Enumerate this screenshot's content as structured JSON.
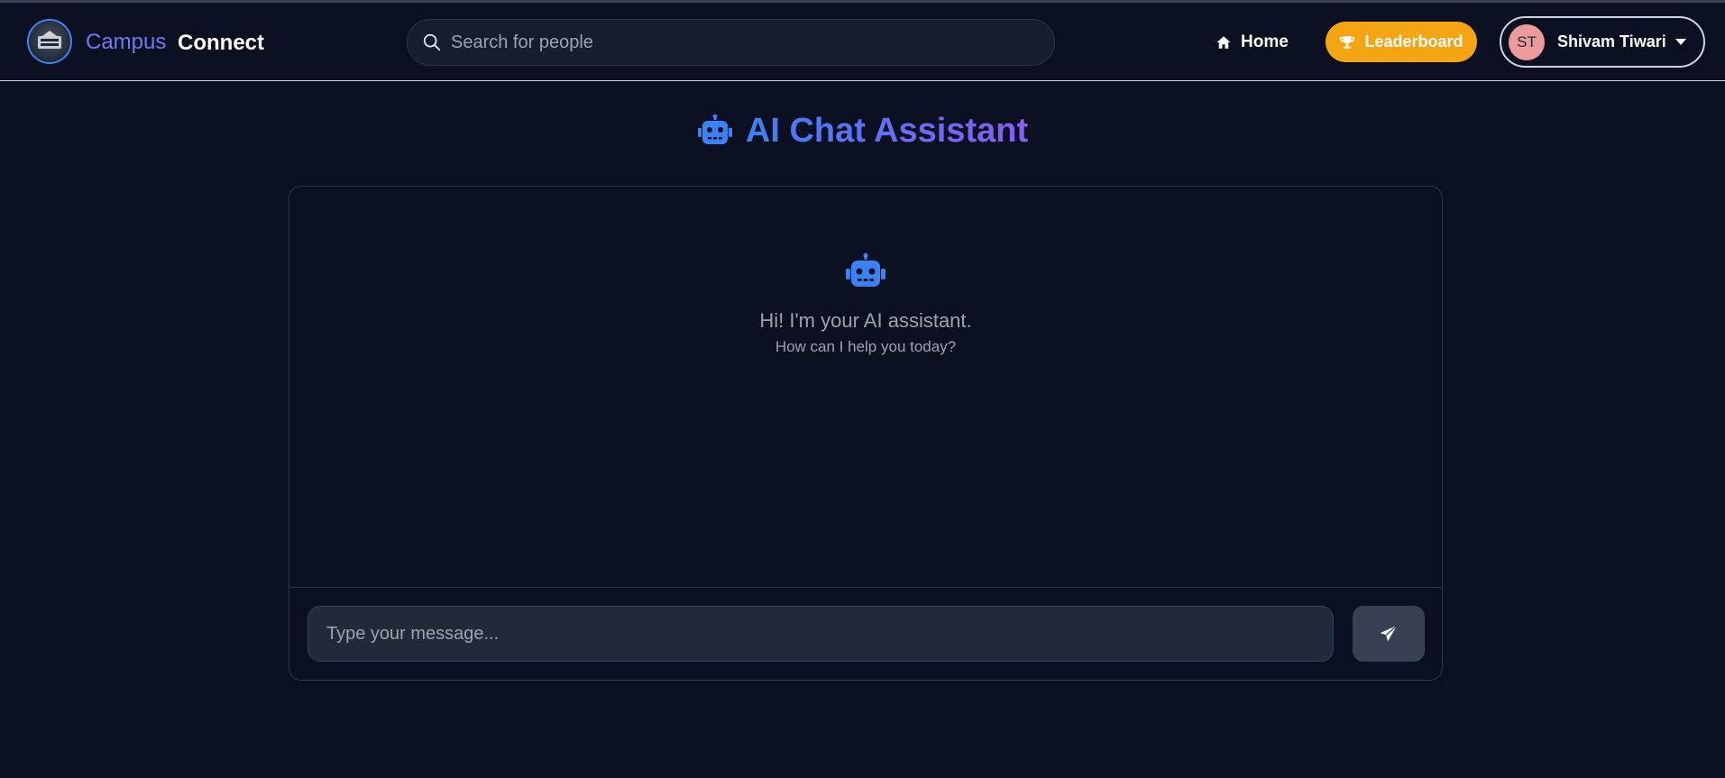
{
  "navbar": {
    "brand_first": "Campus",
    "brand_second": "Connect",
    "logo_text": "CAMPUS CONNECT",
    "search_placeholder": "Search for people",
    "home_label": "Home",
    "leaderboard_label": "Leaderboard",
    "user_initials": "ST",
    "user_name": "Shivam Tiwari"
  },
  "page": {
    "title": "AI Chat Assistant"
  },
  "chat": {
    "welcome_title": "Hi! I'm your AI assistant.",
    "welcome_subtitle": "How can I help you today?",
    "input_placeholder": "Type your message..."
  },
  "colors": {
    "background": "#0b1020",
    "brand_campus": "#6d7cf3",
    "leaderboard_bg": "#f5a512",
    "title_gradient_start": "#3b82f6",
    "title_gradient_end": "#8b5cf6",
    "avatar_bg": "#ec9a9a"
  },
  "icons": [
    "search-icon",
    "home-icon",
    "trophy-icon",
    "chevron-down-icon",
    "robot-icon",
    "send-icon"
  ]
}
